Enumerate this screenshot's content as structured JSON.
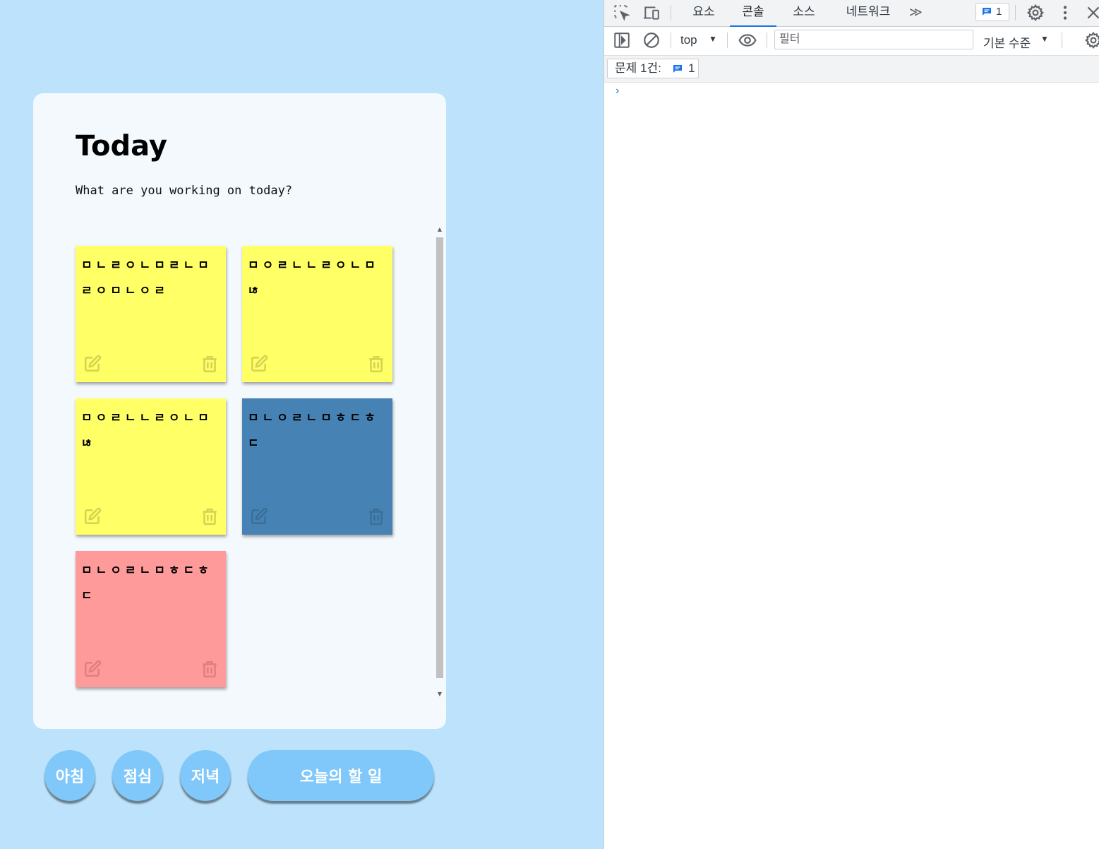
{
  "card": {
    "title": "Today",
    "subtitle": "What are you working on today?"
  },
  "notes": [
    {
      "text": "ㅁㄴㄹㅇㄴㅁㄹㄴㅁㄹㅇㅁㄴㅇㄹ",
      "color": "#ffff66",
      "icon_color": "#d8d254"
    },
    {
      "text": "ㅁㅇㄹㄴㄴㄹㅇㄴㅁㄶ",
      "color": "#ffff66",
      "icon_color": "#d8d254"
    },
    {
      "text": "ㅁㅇㄹㄴㄴㄹㅇㄴㅁㄶ",
      "color": "#ffff66",
      "icon_color": "#d8d254"
    },
    {
      "text": "ㅁㄴㅇㄹㄴㅁㅎㄷㅎㄷ",
      "color": "#4682b4",
      "icon_color": "#3a6f9a"
    },
    {
      "text": "ㅁㄴㅇㄹㄴㅁㅎㄷㅎㄷ",
      "color": "#ff9a9a",
      "icon_color": "#e07f80"
    }
  ],
  "buttons": {
    "morning": "아침",
    "lunch": "점심",
    "dinner": "저녁",
    "today_todo": "오늘의 할 일"
  },
  "devtools": {
    "tabs": [
      "요소",
      "콘솔",
      "소스",
      "네트워크"
    ],
    "active_tab": "콘솔",
    "more_tabs": "≫",
    "issues_badge_count": "1",
    "context": "top",
    "filter_placeholder": "필터",
    "log_level": "기본 수준",
    "issues_label": "문제 1건:",
    "issues_count": "1",
    "prompt": "›",
    "accent_color": "#1a73e8"
  }
}
